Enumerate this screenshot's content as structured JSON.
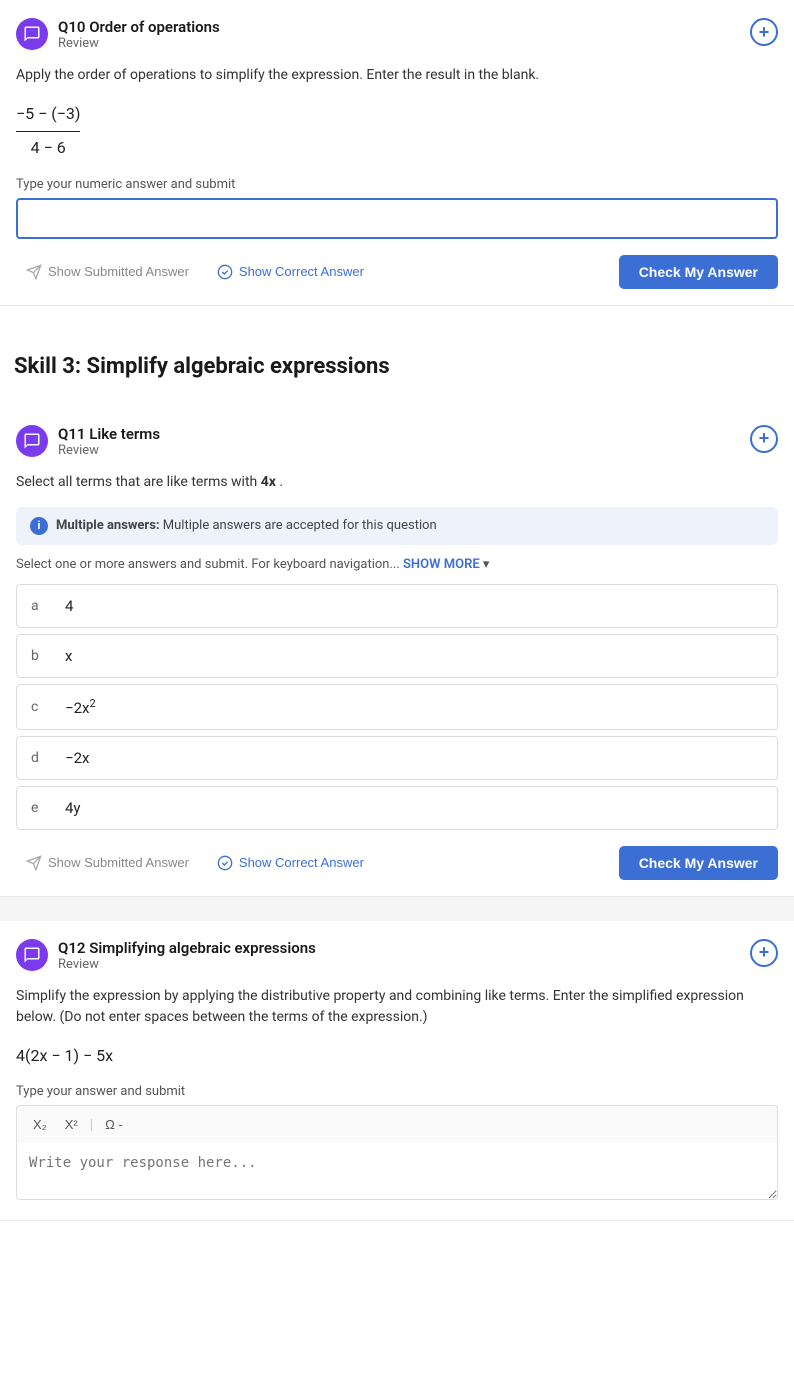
{
  "q10": {
    "id": "Q10",
    "title": "Order of operations",
    "subtitle": "Review",
    "instruction": "Apply the order of operations to simplify the expression. Enter the result in the blank.",
    "expression_numerator": "−5 − (−3)",
    "expression_denominator": "4 − 6",
    "input_label": "Type your numeric answer and submit",
    "input_placeholder": "",
    "show_submitted_label": "Show Submitted Answer",
    "show_correct_label": "Show Correct Answer",
    "check_btn_label": "Check My Answer"
  },
  "skill3": {
    "title": "Skill 3: Simplify algebraic expressions"
  },
  "q11": {
    "id": "Q11",
    "title": "Like terms",
    "subtitle": "Review",
    "instruction_part1": "Select all terms that are like terms with",
    "instruction_term": "4x",
    "instruction_part2": ".",
    "info_label": "Multiple answers:",
    "info_text": "Multiple answers are accepted for this question",
    "nav_text": "Select one or more answers and submit. For keyboard navigation...",
    "show_more_label": "SHOW MORE",
    "choices": [
      {
        "label": "a",
        "content": "4"
      },
      {
        "label": "b",
        "content": "x"
      },
      {
        "label": "c",
        "content": "−2x²",
        "has_sup": true
      },
      {
        "label": "d",
        "content": "−2x"
      },
      {
        "label": "e",
        "content": "4y"
      }
    ],
    "show_submitted_label": "Show Submitted Answer",
    "show_correct_label": "Show Correct Answer",
    "check_btn_label": "Check My Answer"
  },
  "q12": {
    "id": "Q12",
    "title": "Simplifying algebraic expressions",
    "subtitle": "Review",
    "instruction": "Simplify the expression by applying the distributive property and combining like terms. Enter the simplified expression below. (Do not enter spaces between the terms of the expression.)",
    "expression": "4(2x − 1) − 5x",
    "input_label": "Type your answer and submit",
    "toolbar_sub": "X₂",
    "toolbar_sup": "X²",
    "toolbar_omega": "Ω -",
    "input_placeholder": "Write your response here..."
  },
  "icons": {
    "avatar": "chat-icon",
    "plus": "+",
    "submitted_icon": "plane-icon",
    "correct_icon": "check-circle-icon"
  }
}
